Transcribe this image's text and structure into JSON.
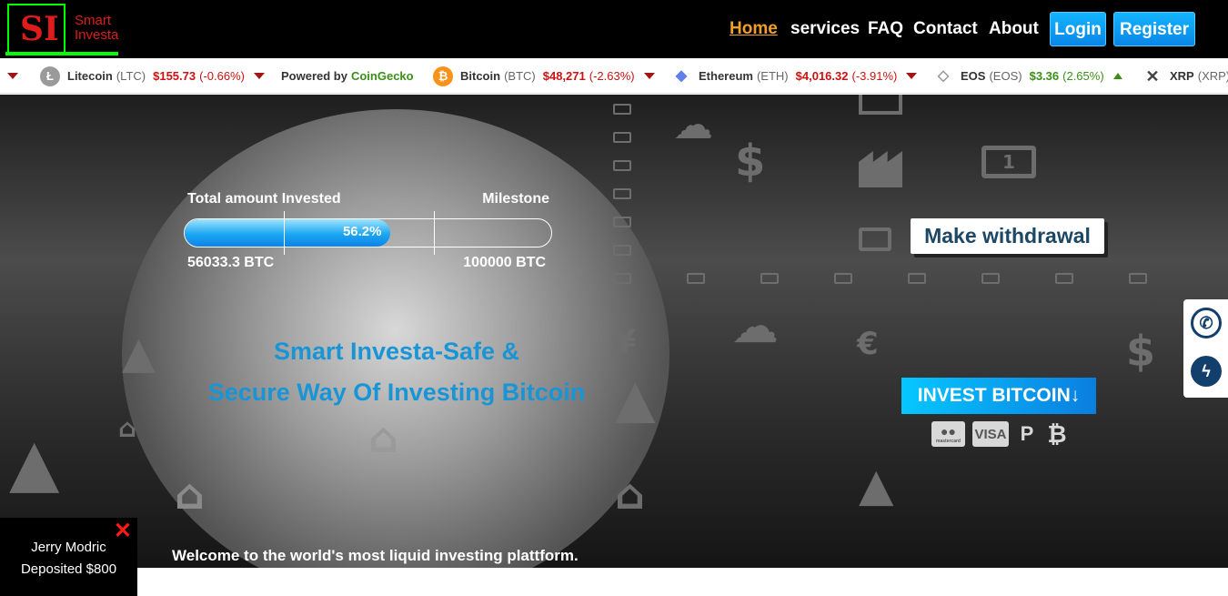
{
  "brand": {
    "mark": "SI",
    "line1": "Smart",
    "line2": "Investa"
  },
  "nav": {
    "home": "Home",
    "services": "services",
    "faq": "FAQ",
    "contact": "Contact",
    "about": "About",
    "login": "Login",
    "register": "Register"
  },
  "ticker": {
    "powered_by": "Powered by",
    "powered_brand": "CoinGecko",
    "coins": [
      {
        "name": "Litecoin",
        "symbol": "(LTC)",
        "price": "$155.73",
        "change": "(-0.66%)",
        "direction": "down",
        "icon": "litecoin-icon",
        "color": "#9a9a9a"
      },
      {
        "name": "Bitcoin",
        "symbol": "(BTC)",
        "price": "$48,271",
        "change": "(-2.63%)",
        "direction": "down",
        "icon": "bitcoin-icon",
        "color": "#f7931a"
      },
      {
        "name": "Ethereum",
        "symbol": "(ETH)",
        "price": "$4,016.32",
        "change": "(-3.91%)",
        "direction": "down",
        "icon": "ethereum-icon",
        "color": "#627eea"
      },
      {
        "name": "EOS",
        "symbol": "(EOS)",
        "price": "$3.36",
        "change": "(2.65%)",
        "direction": "up",
        "icon": "eos-icon",
        "color": "#999999"
      },
      {
        "name": "XRP",
        "symbol": "(XRP)",
        "icon": "xrp-icon",
        "color": "#444444"
      }
    ]
  },
  "progress": {
    "total_label": "Total amount Invested",
    "milestone_label": "Milestone",
    "percent": "56.2%",
    "fraction": 0.562,
    "invested_value": "56033.3 BTC",
    "milestone_value": "100000 BTC"
  },
  "headline": {
    "line1": "Smart Investa-Safe &",
    "line2": "Secure Way Of Investing Bitcoin"
  },
  "buttons": {
    "withdraw": "Make withdrawal",
    "invest": "INVEST BITCOIN↓"
  },
  "payments": {
    "visa": "VISA",
    "mastercard_caption": "mastercard"
  },
  "welcome": "Welcome to the world's most liquid investing plattform.",
  "toast": {
    "name": "Jerry Modric",
    "message": "Deposited $800",
    "close": "✕"
  },
  "colors": {
    "accent": "#1995d6",
    "nav_active": "#f3a02b",
    "brand_green": "#00ff00",
    "brand_red": "#e01b1b"
  }
}
